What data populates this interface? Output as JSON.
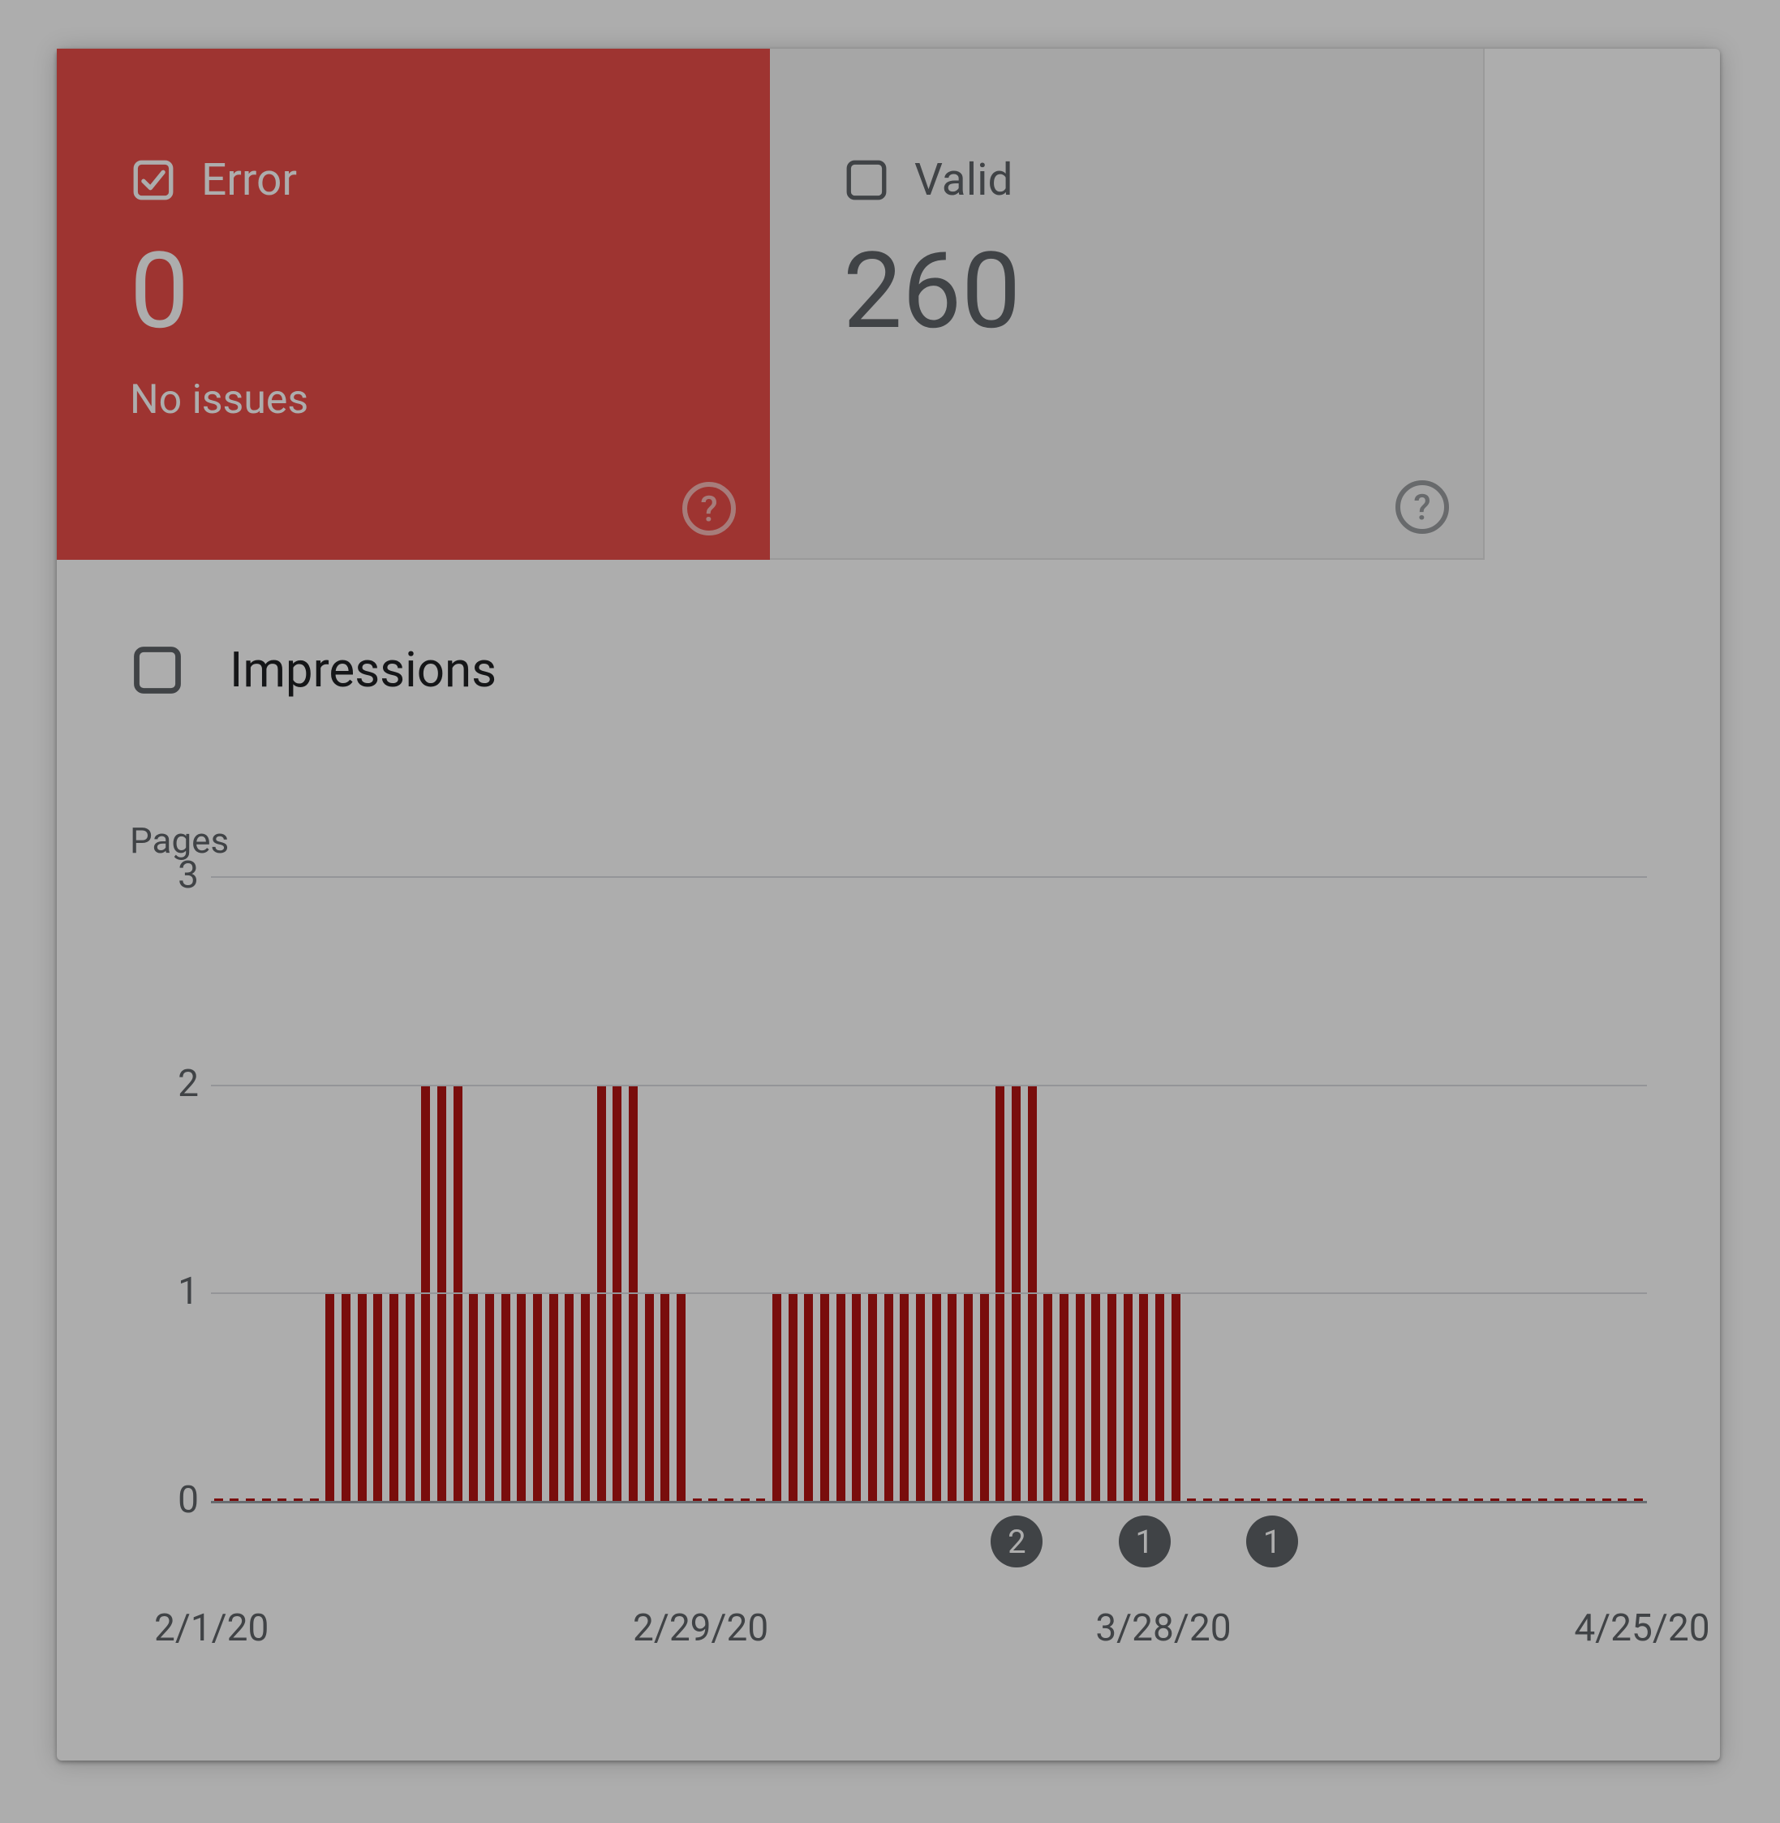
{
  "tabs": {
    "error": {
      "label": "Error",
      "value": "0",
      "sub": "No issues",
      "checked": true
    },
    "valid": {
      "label": "Valid",
      "value": "260",
      "checked": false
    }
  },
  "impressions": {
    "label": "Impressions",
    "checked": false
  },
  "chart_data": {
    "type": "bar",
    "title": "Pages",
    "ylabel": "Pages",
    "xlabel": "",
    "ylim": [
      0,
      3
    ],
    "yTicks": [
      0,
      1,
      2,
      3
    ],
    "xTicks": [
      "2/1/20",
      "2/29/20",
      "3/28/20",
      "4/25/20"
    ],
    "categories": [
      "2/1/20",
      "2/2/20",
      "2/3/20",
      "2/4/20",
      "2/5/20",
      "2/6/20",
      "2/7/20",
      "2/8/20",
      "2/9/20",
      "2/10/20",
      "2/11/20",
      "2/12/20",
      "2/13/20",
      "2/14/20",
      "2/15/20",
      "2/16/20",
      "2/17/20",
      "2/18/20",
      "2/19/20",
      "2/20/20",
      "2/21/20",
      "2/22/20",
      "2/23/20",
      "2/24/20",
      "2/25/20",
      "2/26/20",
      "2/27/20",
      "2/28/20",
      "2/29/20",
      "3/1/20",
      "3/2/20",
      "3/3/20",
      "3/4/20",
      "3/5/20",
      "3/6/20",
      "3/7/20",
      "3/8/20",
      "3/9/20",
      "3/10/20",
      "3/11/20",
      "3/12/20",
      "3/13/20",
      "3/14/20",
      "3/15/20",
      "3/16/20",
      "3/17/20",
      "3/18/20",
      "3/19/20",
      "3/20/20",
      "3/21/20",
      "3/22/20",
      "3/23/20",
      "3/24/20",
      "3/25/20",
      "3/26/20",
      "3/27/20",
      "3/28/20",
      "3/29/20",
      "3/30/20",
      "3/31/20",
      "4/1/20",
      "4/2/20",
      "4/3/20",
      "4/4/20",
      "4/5/20",
      "4/6/20",
      "4/7/20",
      "4/8/20",
      "4/9/20",
      "4/10/20",
      "4/11/20",
      "4/12/20",
      "4/13/20",
      "4/14/20",
      "4/15/20",
      "4/16/20",
      "4/17/20",
      "4/18/20",
      "4/19/20",
      "4/20/20",
      "4/21/20",
      "4/22/20",
      "4/23/20",
      "4/24/20",
      "4/25/20",
      "4/26/20",
      "4/27/20",
      "4/28/20",
      "4/29/20",
      "4/30/20"
    ],
    "values": [
      0,
      0,
      0,
      0,
      0,
      0,
      0,
      1,
      1,
      1,
      1,
      1,
      1,
      2,
      2,
      2,
      1,
      1,
      1,
      1,
      1,
      1,
      1,
      1,
      2,
      2,
      2,
      1,
      1,
      1,
      0,
      0,
      0,
      0,
      0,
      1,
      1,
      1,
      1,
      1,
      1,
      1,
      1,
      1,
      1,
      1,
      1,
      1,
      1,
      2,
      2,
      2,
      1,
      1,
      1,
      1,
      1,
      1,
      1,
      1,
      1,
      0,
      0,
      0,
      0,
      0,
      0,
      0,
      0,
      0,
      0,
      0,
      0,
      0,
      0,
      0,
      0,
      0,
      0,
      0,
      0,
      0,
      0,
      0,
      0,
      0,
      0,
      0,
      0,
      0
    ],
    "markers": [
      {
        "index": 50,
        "label": "2"
      },
      {
        "index": 58,
        "label": "1"
      },
      {
        "index": 66,
        "label": "1"
      }
    ]
  },
  "colors": {
    "error": "#e94d49",
    "bar": "#b31412",
    "muted": "#5f6368"
  }
}
